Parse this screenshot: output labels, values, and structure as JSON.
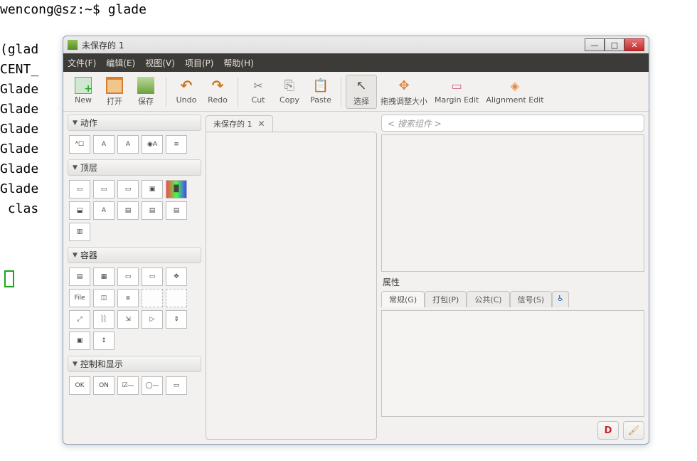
{
  "terminal": {
    "lines": "wencong@sz:~$ glade\n\n(glad                                                             t_fil\nCENT_\nGlade                                                             kEnt\nGlade                                                             kEnt\nGlade                                                             kTex\nGlade                                                             kTex\nGlade                                                             ellRe\nGlade                                                             will\n clas\n                                                                  ksou"
  },
  "window": {
    "title": "未保存的 1"
  },
  "menu": {
    "file": "文件(F)",
    "edit": "编辑(E)",
    "view": "视图(V)",
    "project": "项目(P)",
    "help": "帮助(H)"
  },
  "toolbar": {
    "new": "New",
    "open": "打开",
    "save": "保存",
    "undo": "Undo",
    "redo": "Redo",
    "cut": "Cut",
    "copy": "Copy",
    "paste": "Paste",
    "select": "选择",
    "drag": "拖拽调整大小",
    "margin": "Margin Edit",
    "align": "Alignment Edit"
  },
  "palette": {
    "group_actions": "动作",
    "group_toplevel": "顶层",
    "group_container": "容器",
    "group_control": "控制和显示",
    "labels": {
      "file": "File",
      "ok": "OK",
      "on": "ON"
    }
  },
  "tab": {
    "title": "未保存的 1"
  },
  "right": {
    "search_placeholder": "< 搜索组件 >",
    "props_label": "属性",
    "tab_general": "常规(G)",
    "tab_pack": "打包(P)",
    "tab_common": "公共(C)",
    "tab_signal": "信号(S)"
  },
  "bottom": {
    "d_label": "D"
  }
}
